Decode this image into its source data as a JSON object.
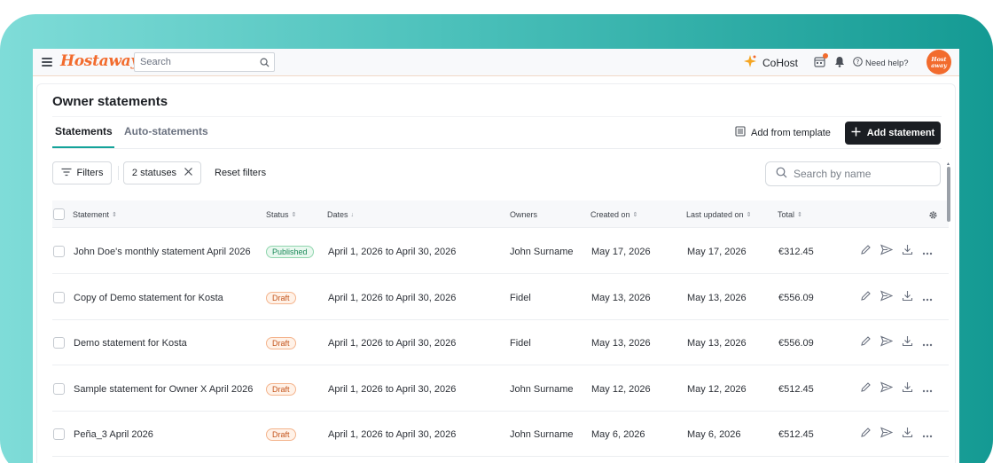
{
  "app": {
    "logo": "Hostaway",
    "search_placeholder": "Search",
    "cohost_label": "CoHost",
    "help_label": "Need help?",
    "avatar_text": "Host away"
  },
  "page": {
    "title": "Owner statements",
    "tabs": [
      {
        "label": "Statements",
        "active": true
      },
      {
        "label": "Auto-statements",
        "active": false
      }
    ],
    "add_from_template_label": "Add from template",
    "add_statement_label": "Add statement"
  },
  "filters": {
    "filters_label": "Filters",
    "status_chip_label": "2 statuses",
    "reset_label": "Reset filters",
    "search_placeholder": "Search by name"
  },
  "table": {
    "columns": [
      "Statement",
      "Status",
      "Dates",
      "Owners",
      "Created on",
      "Last updated on",
      "Total"
    ],
    "rows": [
      {
        "statement": "John Doe's monthly statement April 2026",
        "status": "Published",
        "dates": "April 1, 2026 to April 30, 2026",
        "owners": "John Surname",
        "created": "May 17, 2026",
        "updated": "May 17, 2026",
        "total": "€312.45"
      },
      {
        "statement": "Copy of Demo statement for Kosta",
        "status": "Draft",
        "dates": "April 1, 2026 to April 30, 2026",
        "owners": "Fidel",
        "created": "May 13, 2026",
        "updated": "May 13, 2026",
        "total": "€556.09"
      },
      {
        "statement": "Demo statement for Kosta",
        "status": "Draft",
        "dates": "April 1, 2026 to April 30, 2026",
        "owners": "Fidel",
        "created": "May 13, 2026",
        "updated": "May 13, 2026",
        "total": "€556.09"
      },
      {
        "statement": "Sample statement for Owner X April 2026",
        "status": "Draft",
        "dates": "April 1, 2026 to April 30, 2026",
        "owners": "John Surname",
        "created": "May 12, 2026",
        "updated": "May 12, 2026",
        "total": "€512.45"
      },
      {
        "statement": "Peña_3 April 2026",
        "status": "Draft",
        "dates": "April 1, 2026 to April 30, 2026",
        "owners": "John Surname",
        "created": "May 6, 2026",
        "updated": "May 6, 2026",
        "total": "€512.45"
      }
    ]
  },
  "colors": {
    "brand": "#f26b2d",
    "accent": "#14a39a",
    "primary_button": "#1b1e23",
    "published": "#1b8a5a",
    "draft": "#c4561e"
  },
  "icons": [
    "menu-icon",
    "search-icon",
    "sparkle-icon",
    "calendar-icon",
    "bell-icon",
    "help-icon",
    "template-icon",
    "plus-icon",
    "filter-icon",
    "close-icon",
    "gear-icon",
    "sort-icon",
    "edit-icon",
    "send-icon",
    "download-icon",
    "more-icon"
  ]
}
